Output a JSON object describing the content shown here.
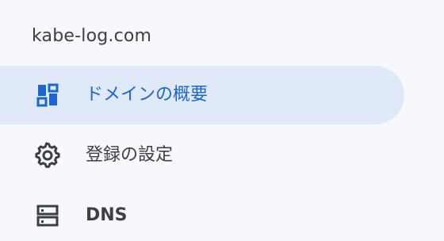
{
  "sidebar": {
    "domain": "kabe-log.com",
    "items": [
      {
        "label": "ドメインの概要",
        "icon": "dashboard-icon",
        "active": true
      },
      {
        "label": "登録の設定",
        "icon": "gear-icon",
        "active": false
      },
      {
        "label": "DNS",
        "icon": "dns-icon",
        "active": false
      }
    ],
    "colors": {
      "accent": "#1a67d2",
      "active_background": "#dfe9f8",
      "background": "#f6f8fb",
      "text": "#3c4043"
    }
  }
}
